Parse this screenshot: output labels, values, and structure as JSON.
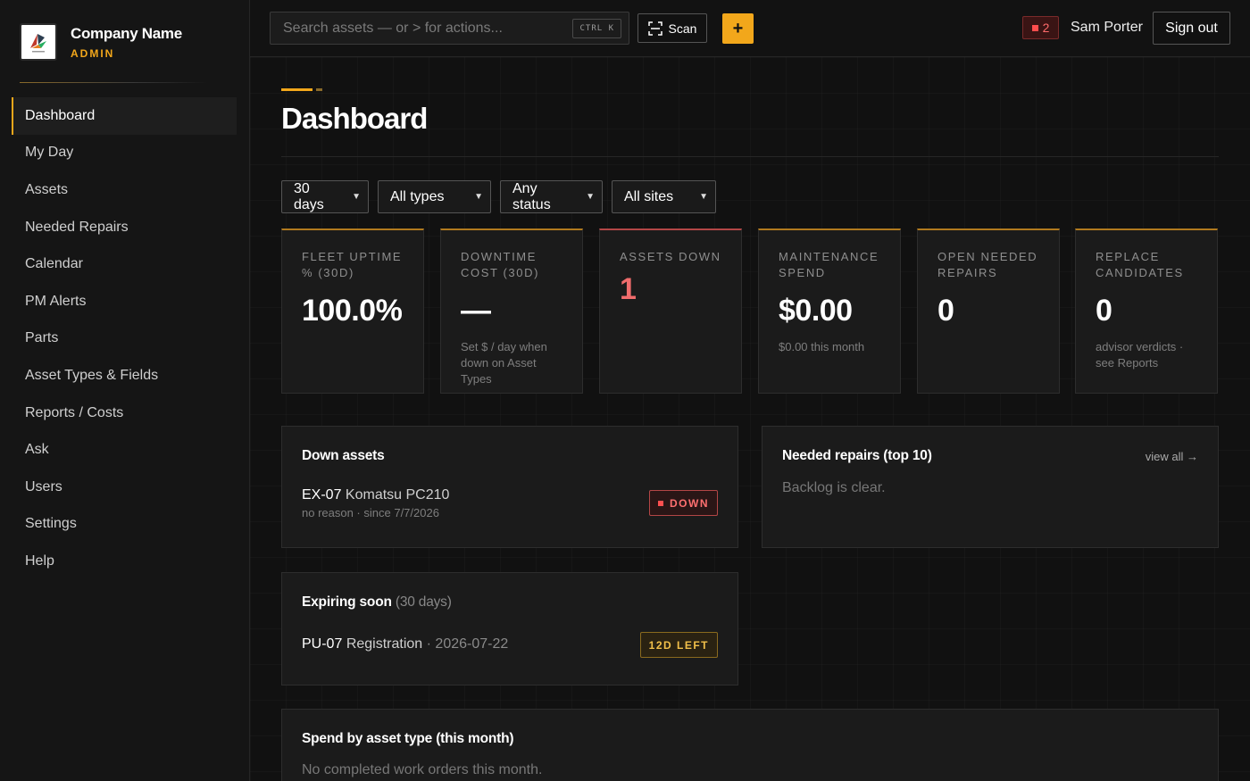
{
  "brand": {
    "name": "Company Name",
    "role": "ADMIN"
  },
  "sidebar": {
    "items": [
      {
        "label": "Dashboard",
        "active": true
      },
      {
        "label": "My Day"
      },
      {
        "label": "Assets"
      },
      {
        "label": "Needed Repairs"
      },
      {
        "label": "Calendar"
      },
      {
        "label": "PM Alerts"
      },
      {
        "label": "Parts"
      },
      {
        "label": "Asset Types & Fields"
      },
      {
        "label": "Reports / Costs"
      },
      {
        "label": "Ask"
      },
      {
        "label": "Users"
      },
      {
        "label": "Settings"
      },
      {
        "label": "Help"
      }
    ]
  },
  "topbar": {
    "search_placeholder": "Search assets — or > for actions...",
    "search_shortcut": "CTRL K",
    "scan_label": "Scan",
    "plus_label": "+",
    "alert_count": "2",
    "user_name": "Sam Porter",
    "signout_label": "Sign out"
  },
  "page": {
    "title": "Dashboard"
  },
  "filters": {
    "range": "30 days",
    "type": "All types",
    "status": "Any status",
    "site": "All sites"
  },
  "cards": [
    {
      "label": "Fleet uptime % (30d)",
      "value": "100.0%",
      "sub": ""
    },
    {
      "label": "Downtime cost (30d)",
      "value": "—",
      "sub": "Set $ / day when down on Asset Types"
    },
    {
      "label": "Assets down",
      "value": "1",
      "sub": ""
    },
    {
      "label": "Maintenance spend",
      "value": "$0.00",
      "sub": "$0.00 this month"
    },
    {
      "label": "Open needed repairs",
      "value": "0",
      "sub": ""
    },
    {
      "label": "Replace candidates",
      "value": "0",
      "sub": "advisor verdicts · see Reports"
    }
  ],
  "down_assets": {
    "title": "Down assets",
    "rows": [
      {
        "id": "EX-07",
        "model": "Komatsu PC210",
        "meta": "no reason · since 7/7/2026",
        "badge": "DOWN"
      }
    ]
  },
  "needed_repairs": {
    "title": "Needed repairs (top 10)",
    "view_all": "view all →",
    "empty": "Backlog is clear."
  },
  "expiring": {
    "title": "Expiring soon",
    "title_suffix": "(30 days)",
    "rows": [
      {
        "id": "PU-07",
        "item": "Registration",
        "date": "· 2026-07-22",
        "badge": "12D LEFT"
      }
    ]
  },
  "spend": {
    "title": "Spend by asset type (this month)",
    "empty": "No completed work orders this month."
  },
  "colors": {
    "accent": "#f2a71b",
    "danger": "#f06c6c",
    "warning": "#f2c04a"
  }
}
